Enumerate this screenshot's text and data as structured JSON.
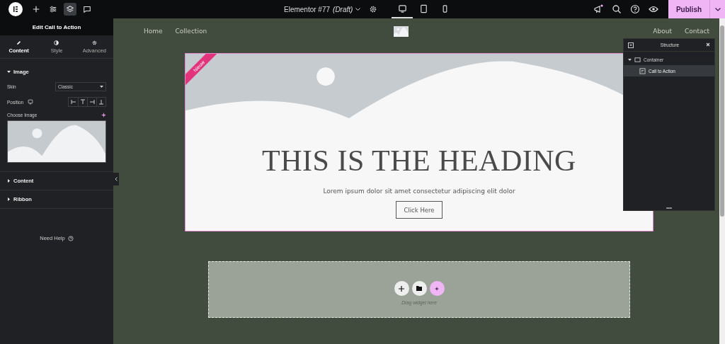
{
  "topbar": {
    "tools": [
      {
        "kind": "add",
        "selected": false
      },
      {
        "kind": "sliders",
        "selected": false
      },
      {
        "kind": "layers",
        "selected": true
      },
      {
        "kind": "comments",
        "selected": false
      }
    ],
    "document_title": "Elementor #77",
    "document_status": "(Draft)",
    "devices": [
      {
        "kind": "desktop",
        "selected": true
      },
      {
        "kind": "tablet",
        "selected": false
      },
      {
        "kind": "mobile",
        "selected": false
      }
    ],
    "publish_label": "Publish"
  },
  "panel": {
    "title": "Edit Call to Action",
    "tabs": [
      {
        "label": "Content",
        "kind": "pencil",
        "selected": true
      },
      {
        "label": "Style",
        "kind": "contrast",
        "selected": false
      },
      {
        "label": "Advanced",
        "kind": "gear",
        "selected": false
      }
    ],
    "sections": [
      {
        "title": "Image",
        "expanded": true,
        "controls": [
          {
            "kind": "select",
            "label": "Skin",
            "value": "Classic"
          },
          {
            "kind": "position",
            "label": "Position"
          },
          {
            "label": "Choose Image"
          }
        ]
      },
      {
        "title": "Content",
        "expanded": false
      },
      {
        "title": "Ribbon",
        "expanded": false
      }
    ],
    "need_help": "Need Help"
  },
  "page": {
    "nav_left": [
      "Home",
      "Collection"
    ],
    "nav_right": [
      "About",
      "Contact"
    ],
    "cta": {
      "ribbon": "Nieuw",
      "heading": "THIS IS THE HEADING",
      "description": "Lorem ipsum dolor sit amet consectetur adipiscing elit dolor",
      "button": "Click Here"
    },
    "dropzone": {
      "hint": "Drag widget here"
    }
  },
  "structure": {
    "title": "Structure",
    "tree": [
      {
        "label": "Container",
        "kind": "container",
        "expanded": true,
        "selected": false,
        "children": [
          {
            "label": "Call to Action",
            "kind": "widget",
            "selected": true
          }
        ]
      }
    ]
  }
}
